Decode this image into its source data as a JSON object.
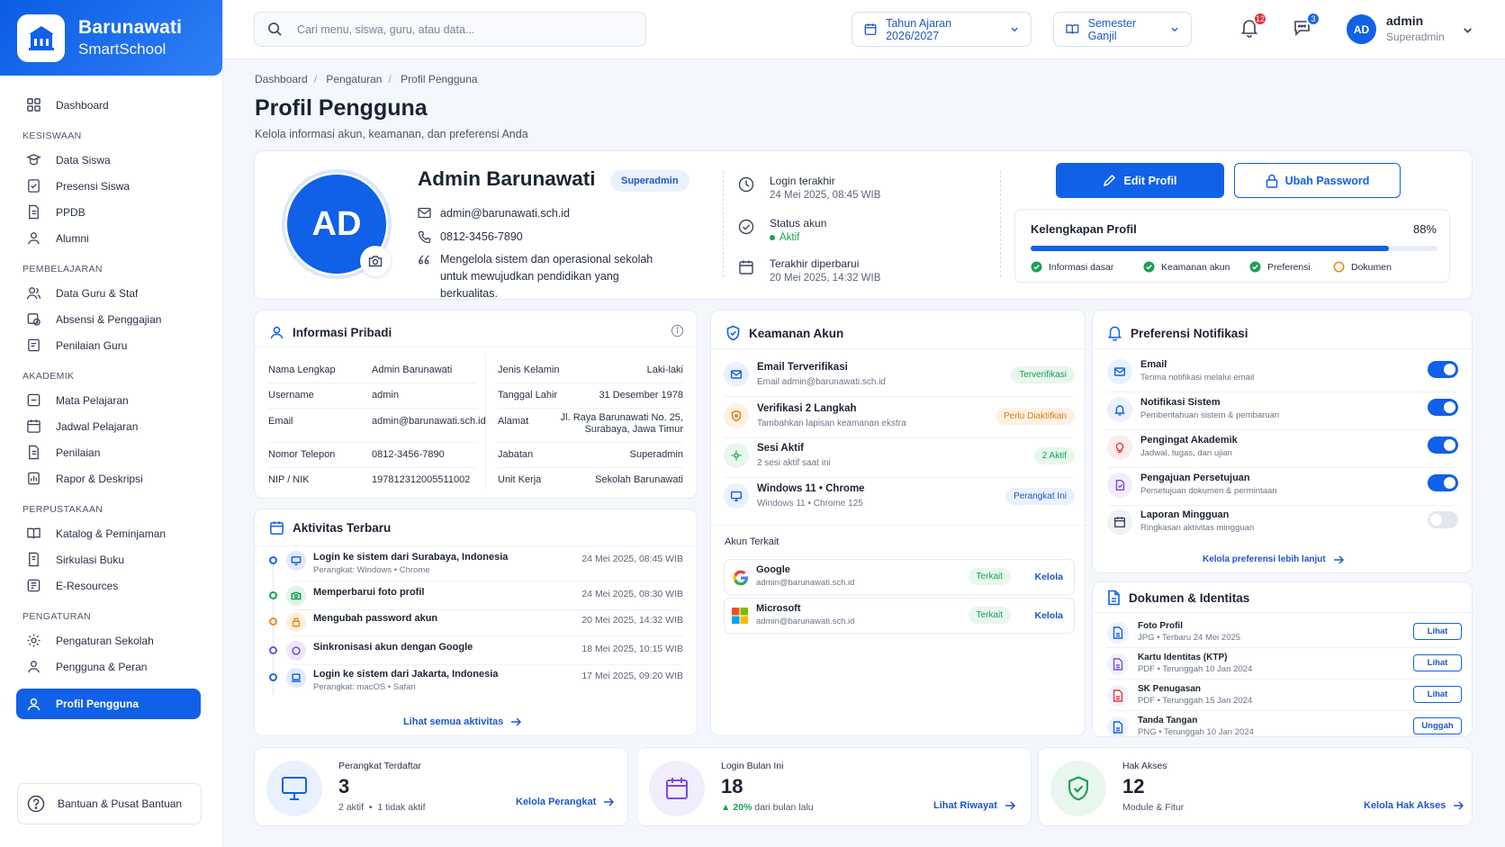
{
  "brand": {
    "name": "Barunawati",
    "sub": "SmartSchool"
  },
  "sidebar": {
    "dashboard": "Dashboard",
    "sections": [
      {
        "title": "KESISWAAN",
        "items": [
          "Data Siswa",
          "Presensi Siswa",
          "PPDB",
          "Alumni"
        ]
      },
      {
        "title": "PEMBELAJARAN",
        "items": [
          "Data Guru & Staf",
          "Absensi & Penggajian",
          "Penilaian Guru"
        ]
      },
      {
        "title": "AKADEMIK",
        "items": [
          "Mata Pelajaran",
          "Jadwal Pelajaran",
          "Penilaian",
          "Rapor & Deskripsi"
        ]
      },
      {
        "title": "PERPUSTAKAAN",
        "items": [
          "Katalog & Peminjaman",
          "Sirkulasi Buku",
          "E-Resources"
        ]
      },
      {
        "title": "PENGATURAN",
        "items": [
          "Pengaturan Sekolah",
          "Pengguna & Peran"
        ]
      }
    ],
    "active": "Profil Pengguna",
    "help": "Bantuan & Pusat Bantuan"
  },
  "topbar": {
    "search_placeholder": "Cari menu, siswa, guru, atau data...",
    "year": "Tahun Ajaran 2026/2027",
    "semester": "Semester Ganjil",
    "notif_count": "12",
    "msg_count": "3",
    "avatar": "AD",
    "user_name": "admin",
    "user_role": "Superadmin"
  },
  "breadcrumb": [
    "Dashboard",
    "Pengaturan",
    "Profil Pengguna"
  ],
  "page": {
    "title": "Profil Pengguna",
    "subtitle": "Kelola informasi akun, keamanan, dan preferensi Anda"
  },
  "profile": {
    "initials": "AD",
    "name": "Admin Barunawati",
    "role": "Superadmin",
    "email": "admin@barunawati.sch.id",
    "phone": "0812-3456-7890",
    "bio": "Mengelola sistem dan operasional sekolah untuk mewujudkan pendidikan yang berkualitas.",
    "login_label": "Login terakhir",
    "login_value": "24 Mei 2025, 08:45 WIB",
    "status_label": "Status akun",
    "status_value": "Aktif",
    "updated_label": "Terakhir diperbarui",
    "updated_value": "20 Mei 2025, 14:32 WIB",
    "edit_btn": "Edit Profil",
    "password_btn": "Ubah Password",
    "completeness_title": "Kelengkapan Profil",
    "completeness_pct": "88%",
    "completeness_value": 0.88,
    "completeness_items": [
      "Informasi dasar",
      "Keamanan akun",
      "Preferensi",
      "Dokumen"
    ]
  },
  "info": {
    "title": "Informasi Pribadi",
    "left": [
      {
        "label": "Nama Lengkap",
        "value": "Admin Barunawati"
      },
      {
        "label": "Username",
        "value": "admin"
      },
      {
        "label": "Email",
        "value": "admin@barunawati.sch.id"
      },
      {
        "label": "Nomor Telepon",
        "value": "0812-3456-7890"
      },
      {
        "label": "NIP / NIK",
        "value": "197812312005511002"
      }
    ],
    "right": [
      {
        "label": "Jenis Kelamin",
        "value": "Laki-laki"
      },
      {
        "label": "Tanggal Lahir",
        "value": "31 Desember 1978"
      },
      {
        "label": "Alamat",
        "value": "Jl. Raya Barunawati No. 25,",
        "value2": "Surabaya, Jawa Timur"
      },
      {
        "label": "Jabatan",
        "value": "Superadmin"
      },
      {
        "label": "Unit Kerja",
        "value": "Sekolah Barunawati"
      }
    ]
  },
  "activity": {
    "title": "Aktivitas Terbaru",
    "items": [
      {
        "title": "Login ke sistem dari Surabaya, Indonesia",
        "sub": "Perangkat: Windows • Chrome",
        "date": "24 Mei 2025, 08:45 WIB",
        "color": "#1e64eb"
      },
      {
        "title": "Memperbarui foto profil",
        "sub": "",
        "date": "24 Mei 2025, 08:30 WIB",
        "color": "#1aa055"
      },
      {
        "title": "Mengubah password akun",
        "sub": "",
        "date": "20 Mei 2025, 14:32 WIB",
        "color": "#f28c1a"
      },
      {
        "title": "Sinkronisasi akun dengan Google",
        "sub": "",
        "date": "18 Mei 2025, 10:15 WIB",
        "color": "#7b4be2"
      },
      {
        "title": "Login ke sistem dari Jakarta, Indonesia",
        "sub": "Perangkat: macOS • Safari",
        "date": "17 Mei 2025, 09:20 WIB",
        "color": "#1e64eb"
      }
    ],
    "see_all": "Lihat semua aktivitas"
  },
  "security": {
    "title": "Keamanan Akun",
    "items": [
      {
        "title": "Email Terverifikasi",
        "sub": "Email admin@barunawati.sch.id",
        "pill": "Terverifikasi",
        "type": "green"
      },
      {
        "title": "Verifikasi 2 Langkah",
        "sub": "Tambahkan lapisan keamanan ekstra",
        "pill": "Perlu Diaktifkan",
        "type": "orange"
      },
      {
        "title": "Sesi Aktif",
        "sub": "2 sesi aktif saat ini",
        "pill": "2 Aktif",
        "type": "green"
      },
      {
        "title": "Windows 11 • Chrome",
        "sub": "Windows 11 • Chrome 125",
        "pill": "Perangkat Ini",
        "type": "blue"
      }
    ],
    "linked_title": "Akun Terkait",
    "linked": [
      {
        "name": "Google",
        "email": "admin@barunawati.sch.id",
        "status": "Terkait",
        "action": "Kelola"
      },
      {
        "name": "Microsoft",
        "email": "admin@barunawati.sch.id",
        "status": "Terkait",
        "action": "Kelola"
      }
    ]
  },
  "notif": {
    "title": "Preferensi Notifikasi",
    "items": [
      {
        "title": "Email",
        "sub": "Terima notifikasi melalui email",
        "on": true
      },
      {
        "title": "Notifikasi Sistem",
        "sub": "Pemberitahuan sistem & pembaruan",
        "on": true
      },
      {
        "title": "Pengingat Akademik",
        "sub": "Jadwal, tugas, dan ujian",
        "on": true
      },
      {
        "title": "Pengajuan Persetujuan",
        "sub": "Persetujuan dokumen & permintaan",
        "on": true
      },
      {
        "title": "Laporan Mingguan",
        "sub": "Ringkasan aktivitas mingguan",
        "on": false
      }
    ],
    "more": "Kelola preferensi lebih lanjut"
  },
  "docs": {
    "title": "Dokumen & Identitas",
    "items": [
      {
        "title": "Foto Profil",
        "sub": "JPG • Terbaru 24 Mei 2025",
        "action": "Lihat"
      },
      {
        "title": "Kartu Identitas (KTP)",
        "sub": "PDF • Terunggah 10 Jan 2024",
        "action": "Lihat"
      },
      {
        "title": "SK Penugasan",
        "sub": "PDF • Terunggah 15 Jan 2024",
        "action": "Lihat"
      },
      {
        "title": "Tanda Tangan",
        "sub": "PNG • Terunggah 10 Jan 2024",
        "action": "Unggah"
      }
    ]
  },
  "bottom": [
    {
      "label": "Perangkat Terdaftar",
      "value": "3",
      "sub1": "2 aktif",
      "sub2": "1 tidak aktif",
      "link": "Kelola Perangkat"
    },
    {
      "label": "Login Bulan Ini",
      "value": "18",
      "trend": "20%",
      "trend_text": "dari bulan lalu",
      "link": "Lihat Riwayat"
    },
    {
      "label": "Hak Akses",
      "value": "12",
      "sub1": "Module & Fitur",
      "link": "Kelola Hak Akses"
    }
  ]
}
